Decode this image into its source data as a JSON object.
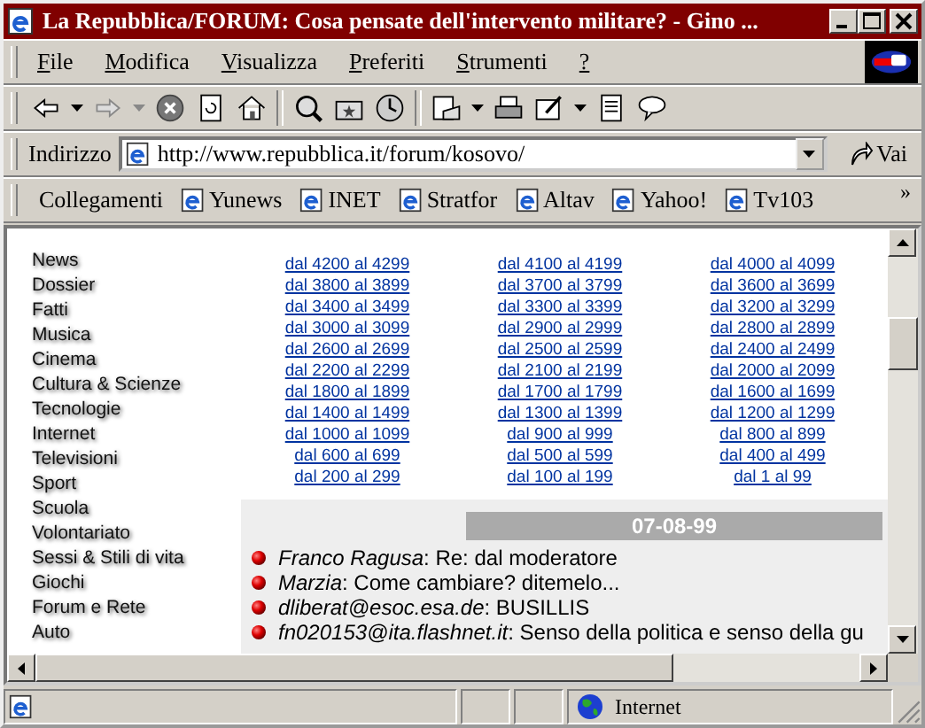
{
  "window": {
    "title": "La Repubblica/FORUM: Cosa pensate dell'intervento militare? - Gino ..."
  },
  "menu": [
    {
      "label": "File"
    },
    {
      "label": "Modifica"
    },
    {
      "label": "Visualizza"
    },
    {
      "label": "Preferiti"
    },
    {
      "label": "Strumenti"
    },
    {
      "label": "?"
    }
  ],
  "address": {
    "label": "Indirizzo",
    "url": "http://www.repubblica.it/forum/kosovo/",
    "go": "Vai"
  },
  "links": {
    "label": "Collegamenti",
    "items": [
      "Yunews",
      "INET",
      "Stratfor",
      "Altav",
      "Yahoo!",
      "Tv103"
    ],
    "more": "»"
  },
  "nav": [
    "News",
    "Dossier",
    "Fatti",
    "Musica",
    "Cinema",
    "Cultura & Scienze",
    "Tecnologie",
    "Internet",
    "Televisioni",
    "Sport",
    "Scuola",
    "Volontariato",
    "Sessi & Stili di vita",
    "Giochi",
    "Forum e Rete",
    "Auto"
  ],
  "archive": [
    [
      "dal 4200 al 4299",
      "dal 4100 al 4199",
      "dal 4000 al 4099"
    ],
    [
      "dal 3800 al 3899",
      "dal 3700 al 3799",
      "dal 3600 al 3699"
    ],
    [
      "dal 3400 al 3499",
      "dal 3300 al 3399",
      "dal 3200 al 3299"
    ],
    [
      "dal 3000 al 3099",
      "dal 2900 al 2999",
      "dal 2800 al 2899"
    ],
    [
      "dal 2600 al 2699",
      "dal 2500 al 2599",
      "dal 2400 al 2499"
    ],
    [
      "dal 2200 al 2299",
      "dal 2100 al 2199",
      "dal 2000 al 2099"
    ],
    [
      "dal 1800 al 1899",
      "dal 1700 al 1799",
      "dal 1600 al 1699"
    ],
    [
      "dal 1400 al 1499",
      "dal 1300 al 1399",
      "dal 1200 al 1299"
    ],
    [
      "dal 1000 al 1099",
      "dal 900 al 999",
      "dal 800 al 899"
    ],
    [
      "dal 600 al 699",
      "dal 500 al 599",
      "dal 400 al 499"
    ],
    [
      "dal 200 al 299",
      "dal 100 al 199",
      "dal 1 al 99"
    ]
  ],
  "messages": {
    "date": "07-08-99",
    "items": [
      {
        "text": "*Franco Ragusa*: Re: dal moderatore"
      },
      {
        "text": "*Marzia*: Come cambiare? ditemelo..."
      },
      {
        "text": "*dliberat@esoc.esa.de*: BUSILLIS"
      },
      {
        "text": "*fn020153@ita.flashnet.it*: Senso della politica e senso della gu"
      }
    ]
  },
  "status_bar": {
    "zone": "Internet"
  }
}
